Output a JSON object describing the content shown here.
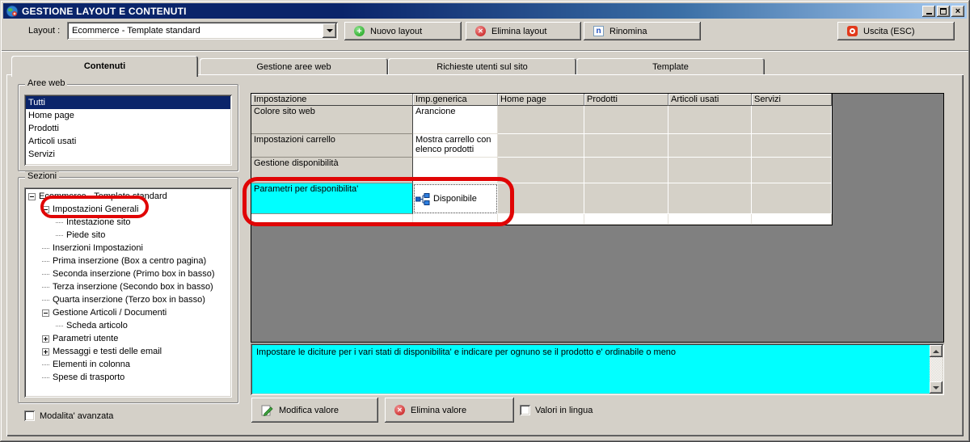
{
  "window": {
    "title": "GESTIONE LAYOUT E CONTENUTI"
  },
  "toolbar": {
    "layout_label": "Layout :",
    "layout_combo_value": "Ecommerce - Template standard",
    "new_layout": "Nuovo layout",
    "delete_layout": "Elimina layout",
    "rename": "Rinomina",
    "exit": "Uscita (ESC)"
  },
  "tabs": [
    {
      "label": "Contenuti",
      "active": true
    },
    {
      "label": "Gestione aree web",
      "active": false
    },
    {
      "label": "Richieste utenti sul sito",
      "active": false
    },
    {
      "label": "Template",
      "active": false
    }
  ],
  "aree_web": {
    "title": "Aree web",
    "items": [
      {
        "label": "Tutti",
        "selected": true
      },
      {
        "label": "Home page",
        "selected": false
      },
      {
        "label": "Prodotti",
        "selected": false
      },
      {
        "label": "Articoli usati",
        "selected": false
      },
      {
        "label": "Servizi",
        "selected": false
      }
    ]
  },
  "sezioni": {
    "title": "Sezioni",
    "advanced_checkbox_label": "Modalita' avanzata",
    "tree": [
      {
        "label": "Ecommerce - Template standard",
        "depth": 0,
        "expander": "minus",
        "highlighted": false
      },
      {
        "label": "Impostazioni Generali",
        "depth": 1,
        "expander": "minus",
        "highlighted": true
      },
      {
        "label": "Intestazione sito",
        "depth": 2,
        "expander": "leaf",
        "highlighted": false
      },
      {
        "label": "Piede sito",
        "depth": 2,
        "expander": "leaf",
        "highlighted": false
      },
      {
        "label": "Inserzioni Impostazioni",
        "depth": 1,
        "expander": "leaf",
        "highlighted": false
      },
      {
        "label": "Prima inserzione (Box a centro pagina)",
        "depth": 1,
        "expander": "leaf",
        "highlighted": false
      },
      {
        "label": "Seconda inserzione (Primo box in basso)",
        "depth": 1,
        "expander": "leaf",
        "highlighted": false
      },
      {
        "label": "Terza inserzione (Secondo box in basso)",
        "depth": 1,
        "expander": "leaf",
        "highlighted": false
      },
      {
        "label": "Quarta inserzione (Terzo box in basso)",
        "depth": 1,
        "expander": "leaf",
        "highlighted": false
      },
      {
        "label": "Gestione Articoli / Documenti",
        "depth": 1,
        "expander": "minus",
        "highlighted": false
      },
      {
        "label": "Scheda articolo",
        "depth": 2,
        "expander": "leaf",
        "highlighted": false
      },
      {
        "label": "Parametri utente",
        "depth": 1,
        "expander": "plus",
        "highlighted": false
      },
      {
        "label": "Messaggi e testi delle email",
        "depth": 1,
        "expander": "plus",
        "highlighted": false
      },
      {
        "label": "Elementi in colonna",
        "depth": 1,
        "expander": "leaf",
        "highlighted": false
      },
      {
        "label": "Spese di trasporto",
        "depth": 1,
        "expander": "leaf",
        "highlighted": false
      }
    ]
  },
  "grid": {
    "columns": [
      "Impostazione",
      "Imp.generica",
      "Home page",
      "Prodotti",
      "Articoli usati",
      "Servizi"
    ],
    "rows": [
      {
        "name": "Colore sito web",
        "generic": "Arancione",
        "highlighted": false
      },
      {
        "name": "Impostazioni carrello",
        "generic": "Mostra carrello con elenco prodotti",
        "highlighted": false
      },
      {
        "name": "Gestione disponibilità",
        "generic": "",
        "highlighted": false
      },
      {
        "name": "Parametri per disponibilita'",
        "generic": "Disponibile",
        "highlighted": true,
        "generic_icon": "hierarchy-icon"
      }
    ]
  },
  "description": {
    "text": "Impostare le diciture per i vari stati di disponibilita' e indicare per ognuno se il prodotto e' ordinabile o meno"
  },
  "footer": {
    "edit_value": "Modifica valore",
    "delete_value": "Elimina valore",
    "lang_checkbox_label": "Valori in lingua"
  },
  "icons": {
    "app": "globe-icon",
    "new_layout": "plus-circle-icon",
    "delete_layout": "x-circle-icon",
    "rename": "letter-n-box-icon",
    "exit": "power-icon",
    "edit_value": "pencil-icon",
    "delete_value": "x-circle-icon",
    "generic_value": "hierarchy-icon"
  },
  "colors": {
    "titlebar_start": "#0A246A",
    "titlebar_end": "#A6CAF0",
    "selection_navy": "#0A246A",
    "highlight_cyan": "#00FFFF",
    "workspace_gray": "#808080",
    "window_face": "#D4D0C8",
    "annotation_red": "#E00505"
  }
}
